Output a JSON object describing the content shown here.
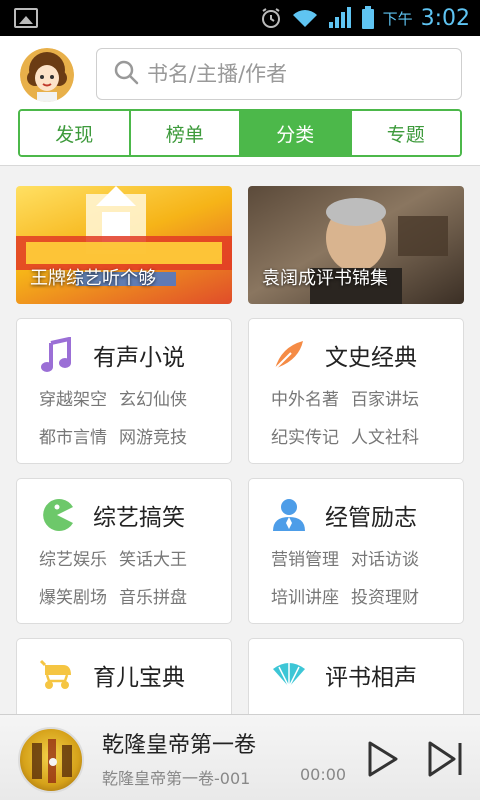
{
  "statusbar": {
    "ampm": "下午",
    "time": "3:02",
    "network": "3G"
  },
  "search": {
    "placeholder": "书名/主播/作者"
  },
  "tabs": [
    {
      "label": "发现",
      "active": false
    },
    {
      "label": "榜单",
      "active": false
    },
    {
      "label": "分类",
      "active": true
    },
    {
      "label": "专题",
      "active": false
    }
  ],
  "banners": [
    {
      "label": "王牌综艺听个够"
    },
    {
      "label": "袁阔成评书锦集"
    }
  ],
  "categories": [
    {
      "title": "有声小说",
      "icon": "music-note-icon",
      "subs": [
        "穿越架空",
        "玄幻仙侠",
        "都市言情",
        "网游竞技"
      ]
    },
    {
      "title": "文史经典",
      "icon": "feather-icon",
      "subs": [
        "中外名著",
        "百家讲坛",
        "纪实传记",
        "人文社科"
      ]
    },
    {
      "title": "综艺搞笑",
      "icon": "pacman-icon",
      "subs": [
        "综艺娱乐",
        "笑话大王",
        "爆笑剧场",
        "音乐拼盘"
      ]
    },
    {
      "title": "经管励志",
      "icon": "person-icon",
      "subs": [
        "营销管理",
        "对话访谈",
        "培训讲座",
        "投资理财"
      ]
    },
    {
      "title": "育儿宝典",
      "icon": "stroller-icon"
    },
    {
      "title": "评书相声",
      "icon": "fan-icon"
    }
  ],
  "player": {
    "title": "乾隆皇帝第一卷",
    "subtitle": "乾隆皇帝第一卷-001",
    "time": "00:00"
  },
  "colors": {
    "accent": "#4cb84a",
    "statusTime": "#5fc4f2"
  }
}
